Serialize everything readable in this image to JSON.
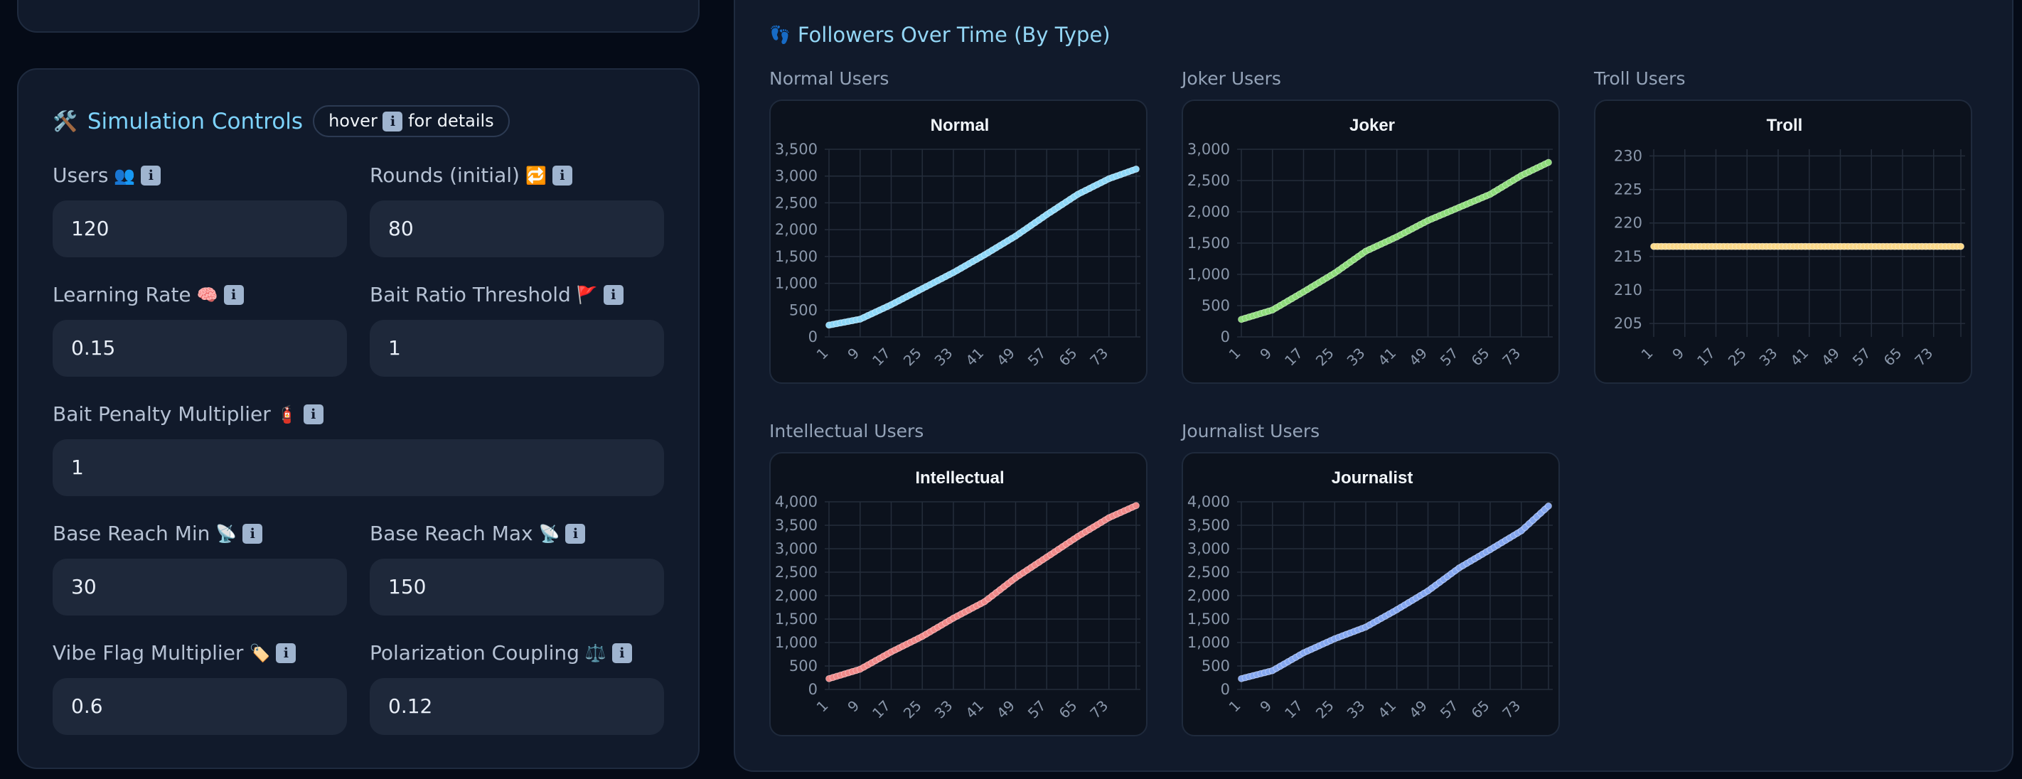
{
  "controls": {
    "title_icon": "🛠️",
    "title": "Simulation Controls",
    "hint_pre": "hover",
    "hint_post": "for details",
    "info_glyph": "i",
    "fields": {
      "users": {
        "label": "Users",
        "emoji": "👥",
        "value": "120"
      },
      "rounds": {
        "label": "Rounds (initial)",
        "emoji": "🔁",
        "value": "80"
      },
      "learning_rate": {
        "label": "Learning Rate",
        "emoji": "🧠",
        "value": "0.15"
      },
      "bait_ratio": {
        "label": "Bait Ratio Threshold",
        "emoji": "🚩",
        "value": "1"
      },
      "bait_penalty": {
        "label": "Bait Penalty Multiplier",
        "emoji": "🧯",
        "value": "1"
      },
      "reach_min": {
        "label": "Base Reach Min",
        "emoji": "📡",
        "value": "30"
      },
      "reach_max": {
        "label": "Base Reach Max",
        "emoji": "📡",
        "value": "150"
      },
      "vibe_flag": {
        "label": "Vibe Flag Multiplier",
        "emoji": "🏷️",
        "value": "0.6"
      },
      "polarization": {
        "label": "Polarization Coupling",
        "emoji": "⚖️",
        "value": "0.12"
      }
    }
  },
  "followers": {
    "title_icon": "👣",
    "title": "Followers Over Time (By Type)",
    "cards": {
      "normal": {
        "label": "Normal Users"
      },
      "joker": {
        "label": "Joker Users"
      },
      "troll": {
        "label": "Troll Users"
      },
      "intellectual": {
        "label": "Intellectual Users"
      },
      "journalist": {
        "label": "Journalist Users"
      }
    }
  },
  "chart_data": [
    {
      "id": "normal",
      "type": "line",
      "title": "Normal",
      "color": "#8fd8f8",
      "x_ticks": [
        "1",
        "9",
        "17",
        "25",
        "33",
        "41",
        "49",
        "57",
        "65",
        "73"
      ],
      "x_count": 80,
      "ylim": [
        0,
        3500
      ],
      "y_ticks": [
        0,
        500,
        1000,
        1500,
        2000,
        2500,
        3000,
        3500
      ],
      "y_tick_labels": [
        "0",
        "500",
        "1,000",
        "1,500",
        "2,000",
        "2,500",
        "3,000",
        "3,500"
      ],
      "anchors": [
        [
          1,
          220
        ],
        [
          9,
          330
        ],
        [
          17,
          600
        ],
        [
          25,
          900
        ],
        [
          33,
          1200
        ],
        [
          41,
          1530
        ],
        [
          49,
          1880
        ],
        [
          57,
          2280
        ],
        [
          65,
          2660
        ],
        [
          73,
          2950
        ],
        [
          80,
          3130
        ]
      ]
    },
    {
      "id": "joker",
      "type": "line",
      "title": "Joker",
      "color": "#8fdc7c",
      "x_ticks": [
        "1",
        "9",
        "17",
        "25",
        "33",
        "41",
        "49",
        "57",
        "65",
        "73"
      ],
      "x_count": 80,
      "ylim": [
        0,
        3000
      ],
      "y_ticks": [
        0,
        500,
        1000,
        1500,
        2000,
        2500,
        3000
      ],
      "y_tick_labels": [
        "0",
        "500",
        "1,000",
        "1,500",
        "2,000",
        "2,500",
        "3,000"
      ],
      "anchors": [
        [
          1,
          280
        ],
        [
          9,
          430
        ],
        [
          17,
          720
        ],
        [
          25,
          1020
        ],
        [
          33,
          1370
        ],
        [
          41,
          1600
        ],
        [
          49,
          1860
        ],
        [
          57,
          2070
        ],
        [
          65,
          2280
        ],
        [
          73,
          2580
        ],
        [
          80,
          2790
        ]
      ]
    },
    {
      "id": "troll",
      "type": "line",
      "title": "Troll",
      "color": "#fcd98a",
      "x_ticks": [
        "1",
        "9",
        "17",
        "25",
        "33",
        "41",
        "49",
        "57",
        "65",
        "73"
      ],
      "x_count": 80,
      "ylim": [
        203,
        231
      ],
      "y_ticks": [
        205,
        210,
        215,
        220,
        225,
        230
      ],
      "y_tick_labels": [
        "205",
        "210",
        "215",
        "220",
        "225",
        "230"
      ],
      "anchors": [
        [
          1,
          216.5
        ],
        [
          80,
          216.5
        ]
      ]
    },
    {
      "id": "intellectual",
      "type": "line",
      "title": "Intellectual",
      "color": "#f08a8a",
      "x_ticks": [
        "1",
        "9",
        "17",
        "25",
        "33",
        "41",
        "49",
        "57",
        "65",
        "73"
      ],
      "x_count": 80,
      "ylim": [
        0,
        4000
      ],
      "y_ticks": [
        0,
        500,
        1000,
        1500,
        2000,
        2500,
        3000,
        3500,
        4000
      ],
      "y_tick_labels": [
        "0",
        "500",
        "1,000",
        "1,500",
        "2,000",
        "2,500",
        "3,000",
        "3,500",
        "4,000"
      ],
      "anchors": [
        [
          1,
          230
        ],
        [
          9,
          430
        ],
        [
          17,
          800
        ],
        [
          25,
          1130
        ],
        [
          33,
          1520
        ],
        [
          41,
          1870
        ],
        [
          49,
          2380
        ],
        [
          57,
          2820
        ],
        [
          65,
          3260
        ],
        [
          73,
          3660
        ],
        [
          80,
          3920
        ]
      ]
    },
    {
      "id": "journalist",
      "type": "line",
      "title": "Journalist",
      "color": "#86a8f0",
      "x_ticks": [
        "1",
        "9",
        "17",
        "25",
        "33",
        "41",
        "49",
        "57",
        "65",
        "73"
      ],
      "x_count": 80,
      "ylim": [
        0,
        4000
      ],
      "y_ticks": [
        0,
        500,
        1000,
        1500,
        2000,
        2500,
        3000,
        3500,
        4000
      ],
      "y_tick_labels": [
        "0",
        "500",
        "1,000",
        "1,500",
        "2,000",
        "2,500",
        "3,000",
        "3,500",
        "4,000"
      ],
      "anchors": [
        [
          1,
          230
        ],
        [
          9,
          400
        ],
        [
          17,
          780
        ],
        [
          25,
          1080
        ],
        [
          33,
          1330
        ],
        [
          41,
          1700
        ],
        [
          49,
          2100
        ],
        [
          57,
          2590
        ],
        [
          65,
          2980
        ],
        [
          73,
          3380
        ],
        [
          80,
          3910
        ]
      ]
    }
  ]
}
